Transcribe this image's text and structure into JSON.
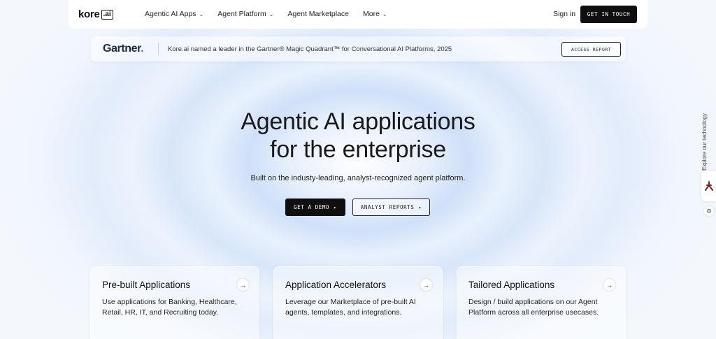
{
  "nav": {
    "logo_text": "kore",
    "logo_suffix": ".ai",
    "menu": [
      {
        "label": "Agentic AI Apps",
        "has_dropdown": true
      },
      {
        "label": "Agent Platform",
        "has_dropdown": true
      },
      {
        "label": "Agent Marketplace",
        "has_dropdown": false
      },
      {
        "label": "More",
        "has_dropdown": true
      }
    ],
    "signin": "Sign in",
    "cta": "GET IN TOUCH"
  },
  "banner": {
    "logo": "Gartner",
    "text": "Kore.ai named a leader in the Gartner® Magic Quadrant™ for Conversational AI Platforms, 2025",
    "button": "ACCESS REPORT"
  },
  "hero": {
    "title_line1": "Agentic AI applications",
    "title_line2": "for the enterprise",
    "subtitle": "Built on the industy-leading, analyst-recognized agent platform.",
    "btn_demo": "GET A DEMO",
    "btn_analyst": "ANALYST REPORTS"
  },
  "cards": [
    {
      "title": "Pre-built Applications",
      "body": "Use applications for Banking, Healthcare, Retail, HR, IT, and Recruiting today."
    },
    {
      "title": "Application Accelerators",
      "body": "Leverage our Marketplace of pre-built AI agents, templates, and integrations."
    },
    {
      "title": "Tailored Applications",
      "body": "Design / build applications on our Agent Platform across all enterprise usecases."
    }
  ],
  "side": {
    "label": "Explore our technology"
  },
  "colors": {
    "primary": "#0f0f0f",
    "background": "#e6effc",
    "gartner_dot": "#1a7fd6"
  },
  "icons": {
    "chevron": "chevron-down-icon",
    "arrow": "arrow-right-icon",
    "gear": "gear-icon"
  }
}
